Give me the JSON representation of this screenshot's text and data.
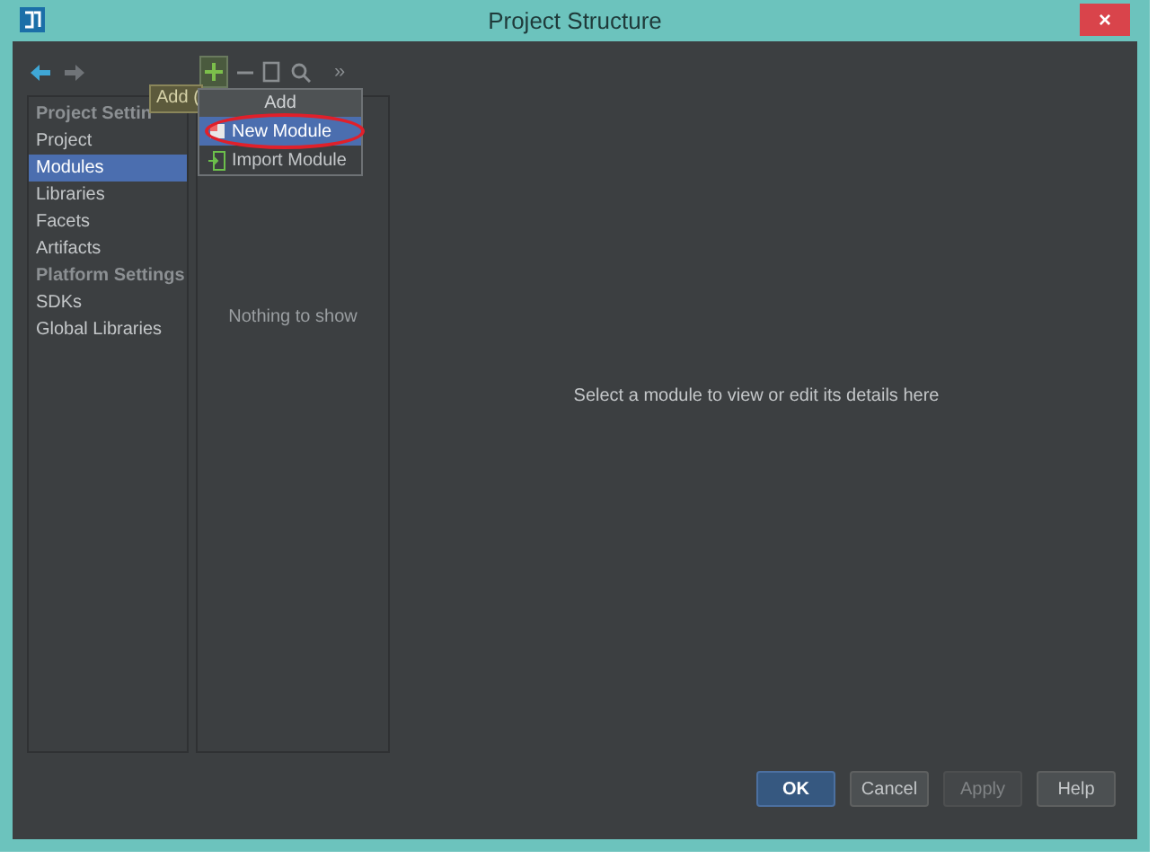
{
  "window": {
    "title": "Project Structure",
    "close": "×"
  },
  "nav": {
    "more": "»"
  },
  "sidebar": [
    {
      "kind": "header",
      "label": "Project Settin"
    },
    {
      "kind": "item",
      "label": "Project",
      "selected": false
    },
    {
      "kind": "item",
      "label": "Modules",
      "selected": true
    },
    {
      "kind": "item",
      "label": "Libraries",
      "selected": false
    },
    {
      "kind": "item",
      "label": "Facets",
      "selected": false
    },
    {
      "kind": "item",
      "label": "Artifacts",
      "selected": false
    },
    {
      "kind": "header",
      "label": "Platform Settings"
    },
    {
      "kind": "item",
      "label": "SDKs",
      "selected": false
    },
    {
      "kind": "item",
      "label": "Global Libraries",
      "selected": false
    }
  ],
  "tooltip": "Add (",
  "add_menu": {
    "title": "Add",
    "items": [
      {
        "label": "New Module",
        "selected": true,
        "circled": true
      },
      {
        "label": "Import Module",
        "selected": false,
        "circled": false
      }
    ]
  },
  "module_list": {
    "empty_text": "Nothing to show"
  },
  "details": {
    "empty_text": "Select a module to view or edit its details here"
  },
  "buttons": [
    {
      "label": "OK",
      "kind": "default",
      "disabled": false
    },
    {
      "label": "Cancel",
      "kind": "normal",
      "disabled": false
    },
    {
      "label": "Apply",
      "kind": "normal",
      "disabled": true
    },
    {
      "label": "Help",
      "kind": "normal",
      "disabled": false
    }
  ]
}
